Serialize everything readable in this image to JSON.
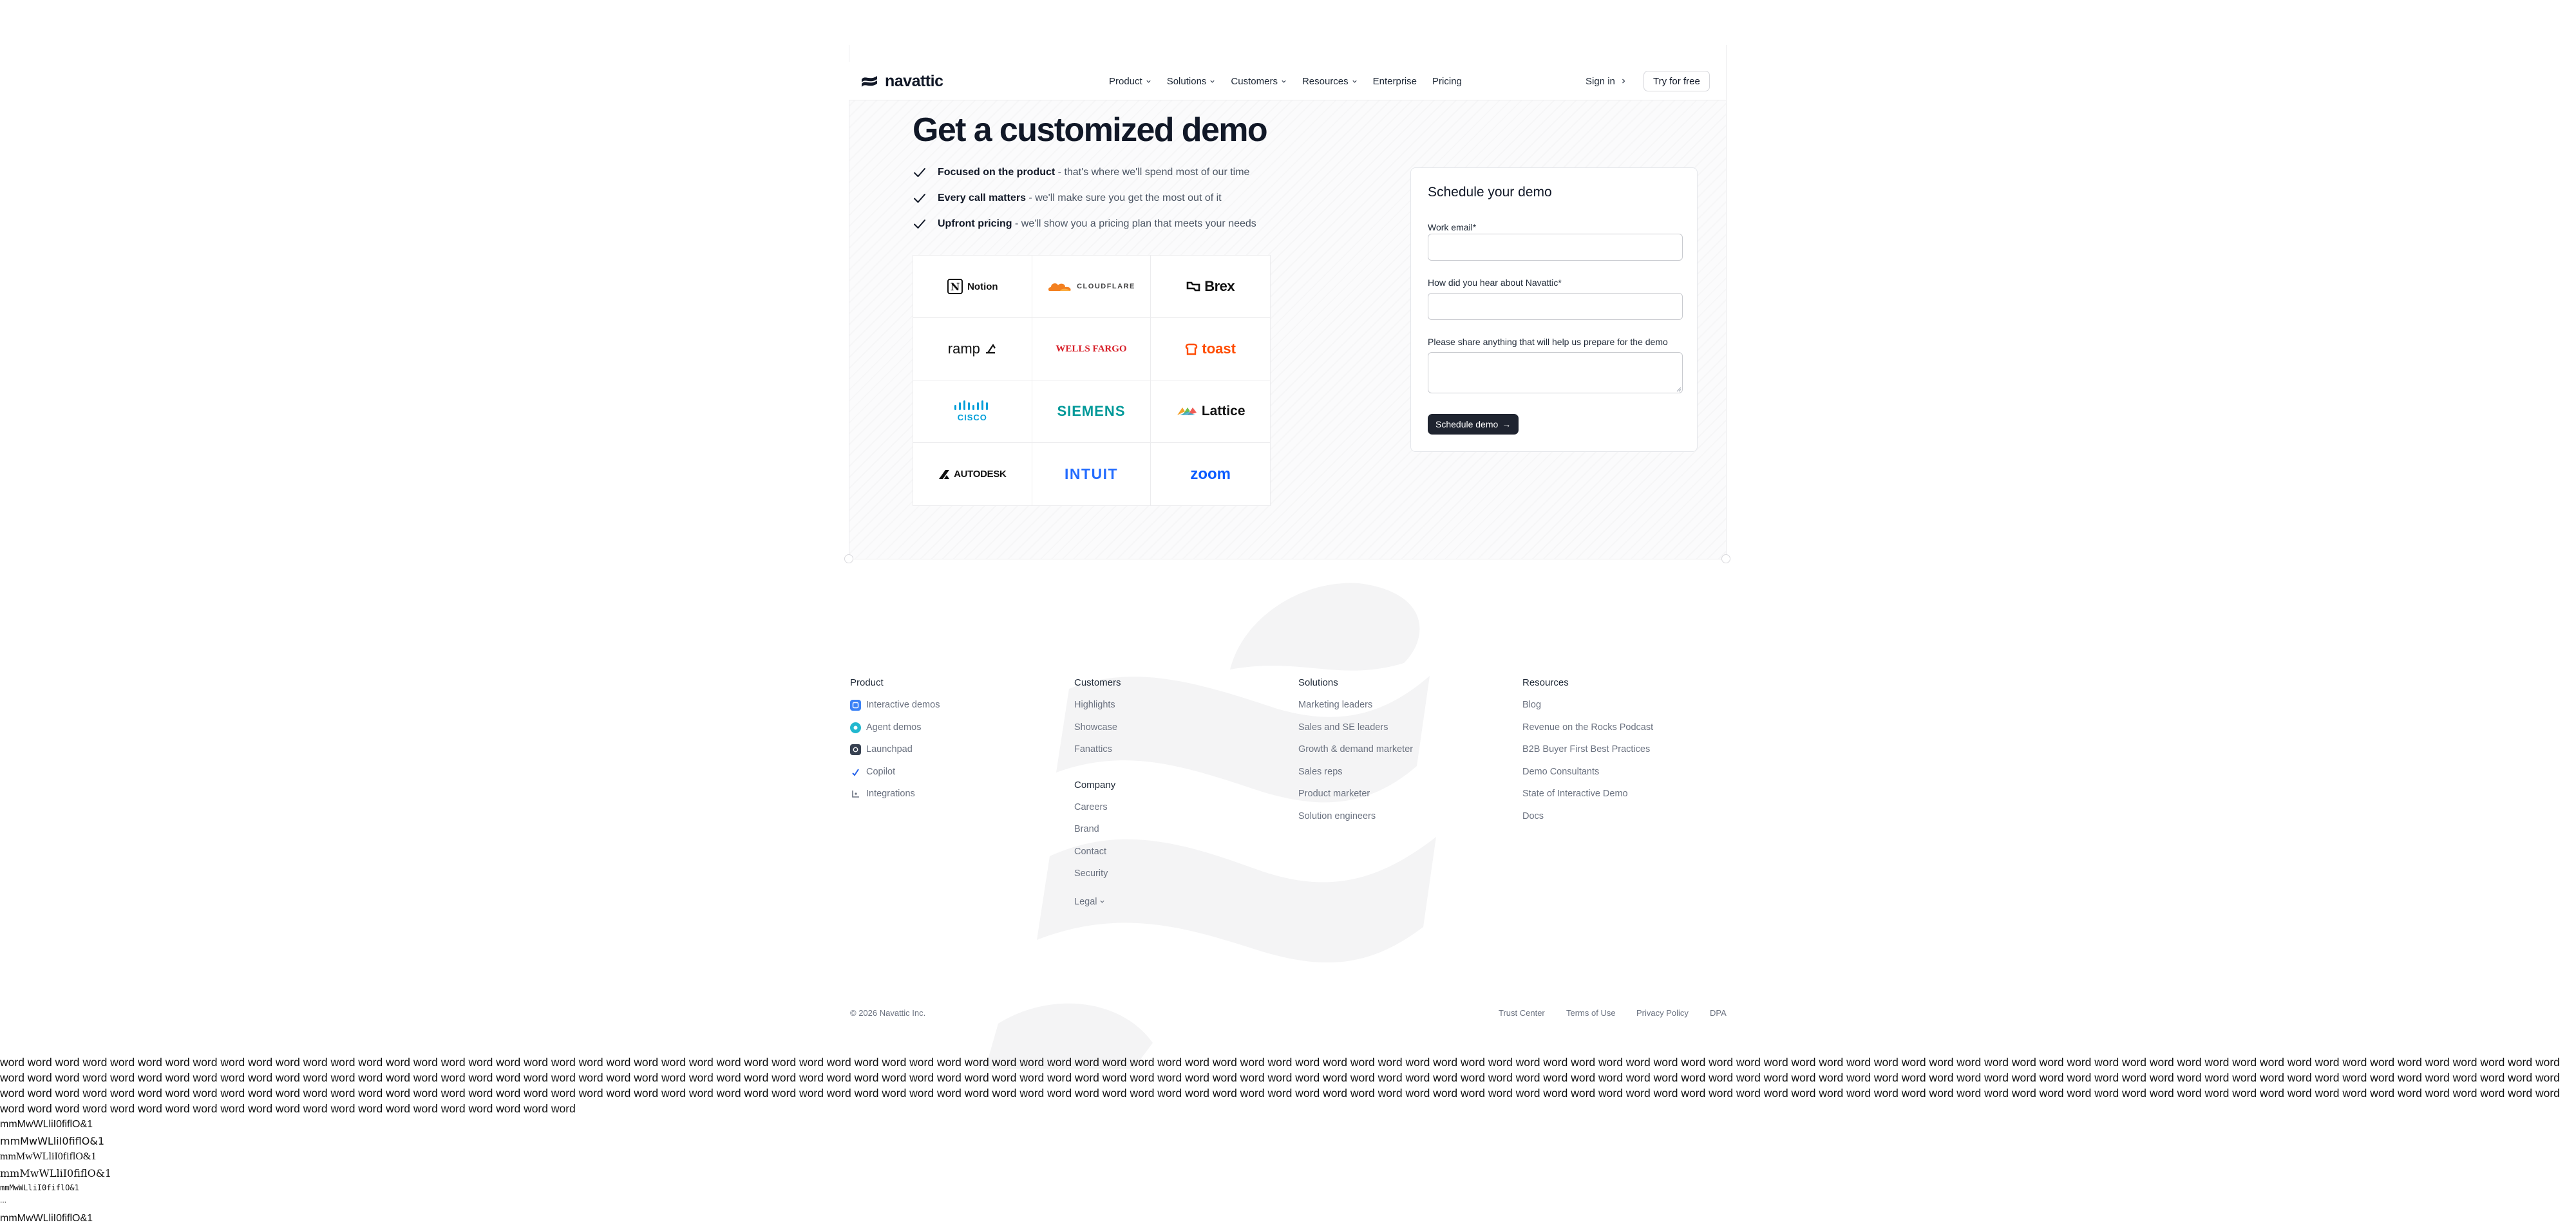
{
  "nav": {
    "brand": "navattic",
    "items": [
      {
        "label": "Product",
        "dropdown": true
      },
      {
        "label": "Solutions",
        "dropdown": true
      },
      {
        "label": "Customers",
        "dropdown": true
      },
      {
        "label": "Resources",
        "dropdown": true
      },
      {
        "label": "Enterprise",
        "dropdown": false
      },
      {
        "label": "Pricing",
        "dropdown": false
      }
    ],
    "sign_in": "Sign in",
    "cta": "Try for free"
  },
  "hero": {
    "title": "Get a customized demo",
    "bullets": [
      {
        "bold": "Focused on the product",
        "rest": " - that's where we'll spend most of our time"
      },
      {
        "bold": "Every call matters",
        "rest": " - we'll make sure you get the most out of it"
      },
      {
        "bold": "Upfront pricing",
        "rest": " - we'll show you a pricing plan that meets your needs"
      }
    ]
  },
  "customer_logos": [
    "Notion",
    "CLOUDFLARE",
    "Brex",
    "ramp",
    "WELLS FARGO",
    "toast",
    "CISCO",
    "SIEMENS",
    "Lattice",
    "AUTODESK",
    "INTUIT",
    "zoom"
  ],
  "form": {
    "title": "Schedule your demo",
    "email_label": "Work email*",
    "email_value": "",
    "source_label": "How did you hear about Navattic*",
    "source_value": "",
    "notes_label": "Please share anything that will help us prepare for the demo",
    "notes_value": "",
    "submit": "Schedule demo",
    "submit_arrow": "→"
  },
  "footer": {
    "product": {
      "title": "Product",
      "links": [
        {
          "label": "Interactive demos",
          "icon": "interactive-demos-icon"
        },
        {
          "label": "Agent demos",
          "icon": "agent-demos-icon"
        },
        {
          "label": "Launchpad",
          "icon": "launchpad-icon"
        },
        {
          "label": "Copilot",
          "icon": "copilot-icon"
        },
        {
          "label": "Integrations",
          "icon": "integrations-icon"
        }
      ]
    },
    "customers": {
      "title": "Customers",
      "links": [
        "Highlights",
        "Showcase",
        "Fanattics"
      ]
    },
    "company": {
      "title": "Company",
      "links": [
        "Careers",
        "Brand",
        "Contact",
        "Security",
        "Legal"
      ]
    },
    "solutions": {
      "title": "Solutions",
      "links": [
        "Marketing leaders",
        "Sales and SE leaders",
        "Growth & demand marketer",
        "Sales reps",
        "Product marketer",
        "Solution engineers"
      ]
    },
    "resources": {
      "title": "Resources",
      "links": [
        "Blog",
        "Revenue on the Rocks Podcast",
        "B2B Buyer First Best Practices",
        "Demo Consultants",
        "State of Interactive Demo",
        "Docs"
      ]
    },
    "copyright": "© 2026 Navattic Inc.",
    "legal_links": [
      "Trust Center",
      "Terms of Use",
      "Privacy Policy",
      "DPA"
    ]
  },
  "filler": {
    "word": "word",
    "count": 300,
    "font_test": "mmMwWLliI0fiflO&1",
    "ellipsis": "..."
  }
}
